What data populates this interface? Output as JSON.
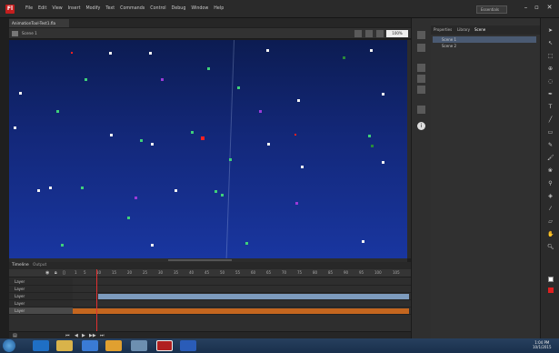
{
  "app_icon": "Fl",
  "menu": [
    "File",
    "Edit",
    "View",
    "Insert",
    "Modify",
    "Text",
    "Commands",
    "Control",
    "Debug",
    "Window",
    "Help"
  ],
  "workspace": "Essentials",
  "document_tab": "AnimationTool-Test1.fla",
  "scene_label": "Scene 1",
  "zoom": "100%",
  "timeline_tabs": [
    "Timeline",
    "Output"
  ],
  "frame_ticks": [
    "1",
    "5",
    "10",
    "15",
    "20",
    "25",
    "30",
    "35",
    "40",
    "45",
    "50",
    "55",
    "60",
    "65",
    "70",
    "75",
    "80",
    "85",
    "90",
    "95",
    "100",
    "105"
  ],
  "layers": [
    "Layer",
    "Layer",
    "Layer",
    "Layer",
    "Layer"
  ],
  "panel_tabs": [
    "Properties",
    "Library",
    "Scene"
  ],
  "scenes": [
    "Scene 1",
    "Scene 2"
  ],
  "clock": {
    "time": "1:04 PM",
    "date": "10/1/2015"
  }
}
